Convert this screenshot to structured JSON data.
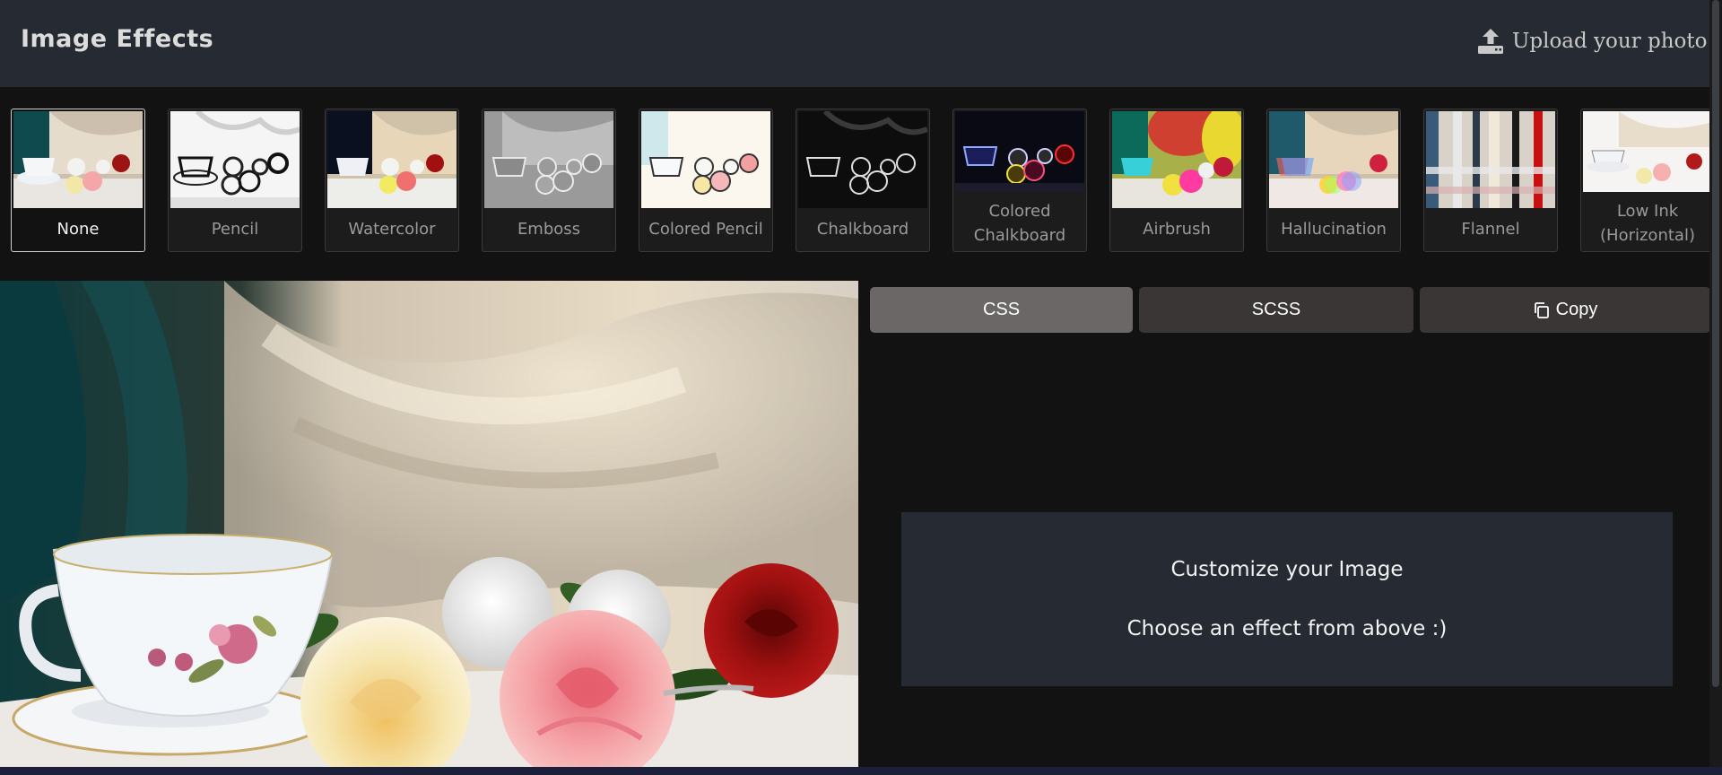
{
  "header": {
    "title": "Image Effects",
    "upload_label": "Upload your photo",
    "upload_icon": "upload-icon"
  },
  "effects": [
    {
      "label": "None",
      "selected": true
    },
    {
      "label": "Pencil",
      "selected": false
    },
    {
      "label": "Watercolor",
      "selected": false
    },
    {
      "label": "Emboss",
      "selected": false
    },
    {
      "label": "Colored Pencil",
      "selected": false
    },
    {
      "label": "Chalkboard",
      "selected": false
    },
    {
      "label": "Colored Chalkboard",
      "selected": false
    },
    {
      "label": "Airbrush",
      "selected": false
    },
    {
      "label": "Hallucination",
      "selected": false
    },
    {
      "label": "Flannel",
      "selected": false
    },
    {
      "label": "Low Ink (Horizontal)",
      "selected": false
    }
  ],
  "code_tabs": {
    "css_label": "CSS",
    "scss_label": "SCSS",
    "copy_label": "Copy",
    "copy_icon": "copy-icon",
    "active": "CSS"
  },
  "info": {
    "line1": "Customize your Image",
    "line2": "Choose an effect from above :)"
  },
  "colors": {
    "header_bg": "#262a32",
    "page_bg": "#121212",
    "active_tab": "#6b6767",
    "inactive_tab": "#3b3636",
    "info_bg": "#262a32"
  }
}
